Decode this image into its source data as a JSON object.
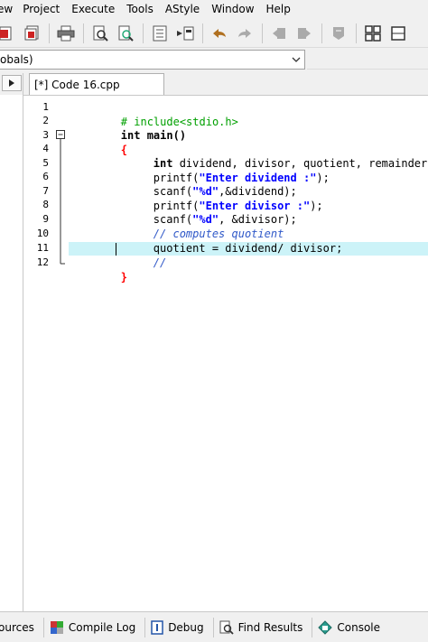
{
  "menu": [
    "ew",
    "Project",
    "Execute",
    "Tools",
    "AStyle",
    "Window",
    "Help"
  ],
  "scope": {
    "value": "obals)"
  },
  "editor_tab": {
    "label": "[*] Code 16.cpp"
  },
  "line_numbers": [
    "1",
    "2",
    "3",
    "4",
    "5",
    "6",
    "7",
    "8",
    "9",
    "10",
    "11",
    "12"
  ],
  "code": {
    "l1": "# include<stdio.h>",
    "l2": "int main()",
    "l3": "{",
    "l4_kw": "int",
    "l4_rest": " dividend, divisor, quotient, remainder;",
    "l5_fn": "printf(",
    "l5_str": "\"Enter dividend :\"",
    "l5_end": ");",
    "l6_fn": "scanf(",
    "l6_str": "\"%d\"",
    "l6_end": ",&dividend);",
    "l7_fn": "printf(",
    "l7_str": "\"Enter divisor :\"",
    "l7_end": ");",
    "l8_fn": "scanf(",
    "l8_str": "\"%d\"",
    "l8_end": ", &divisor);",
    "l9": "// computes quotient",
    "l10": "quotient = dividend/ divisor;",
    "l11": "//",
    "l12": "}"
  },
  "bottom_tabs": [
    {
      "label": "ources",
      "icon": "resources-icon"
    },
    {
      "label": "Compile Log",
      "icon": "compile-log-icon"
    },
    {
      "label": "Debug",
      "icon": "debug-icon"
    },
    {
      "label": "Find Results",
      "icon": "find-results-icon"
    },
    {
      "label": "Console",
      "icon": "console-icon"
    }
  ],
  "colors": {
    "active_line": "#ccf3f8",
    "keyword": "#000000",
    "string": "#0000ff",
    "comment": "#2f58c8",
    "preprocessor": "#00a000",
    "brace": "#ff0000"
  }
}
